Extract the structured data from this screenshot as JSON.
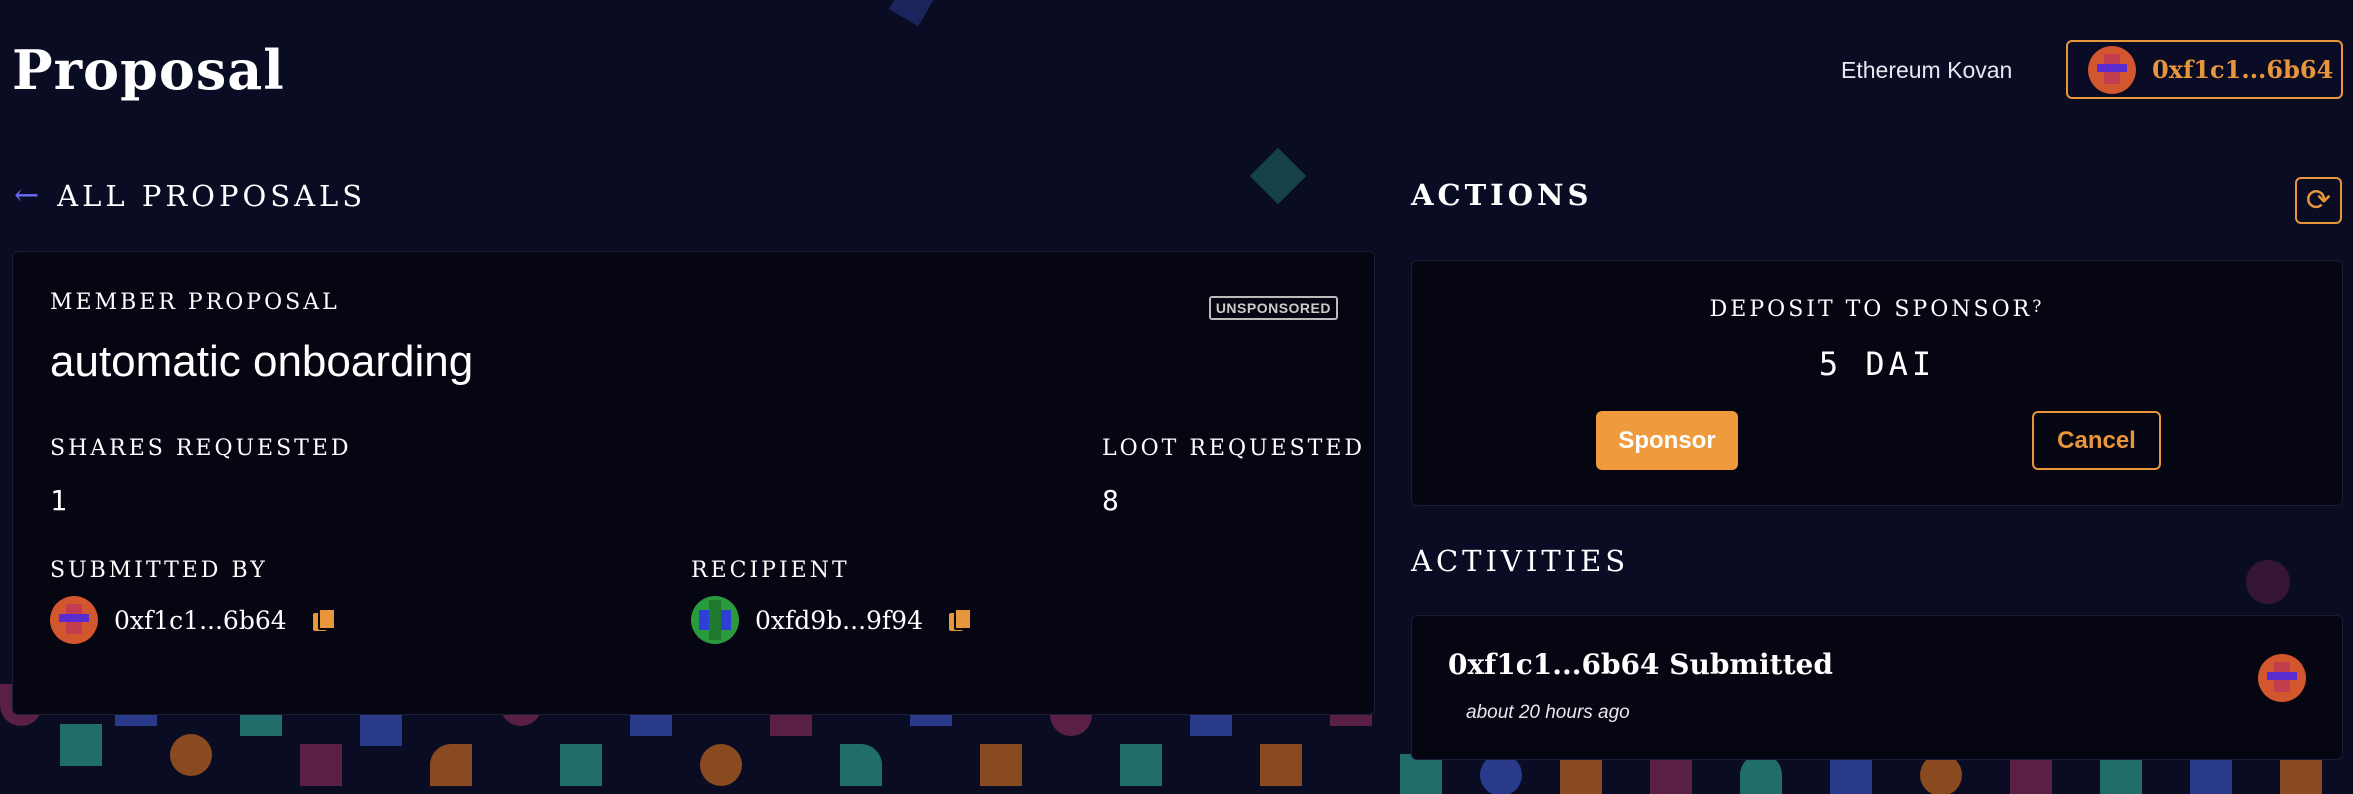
{
  "header": {
    "title": "Proposal",
    "network": "Ethereum Kovan",
    "account": "0xf1c1...6b64"
  },
  "back_link": {
    "label": "ALL PROPOSALS"
  },
  "proposal": {
    "type": "MEMBER PROPOSAL",
    "status_badge": "UNSPONSORED",
    "title": "automatic onboarding",
    "shares_label": "SHARES REQUESTED",
    "shares_value": "1",
    "loot_label": "LOOT REQUESTED",
    "loot_value": "8",
    "submitted_by_label": "SUBMITTED BY",
    "submitted_by": "0xf1c1...6b64",
    "recipient_label": "RECIPIENT",
    "recipient": "0xfd9b...9f94"
  },
  "actions": {
    "heading": "ACTIONS",
    "deposit_label": "DEPOSIT TO SPONSOR",
    "deposit_value": "5 DAI",
    "sponsor_label": "Sponsor",
    "cancel_label": "Cancel"
  },
  "activities": {
    "heading": "ACTIVITIES",
    "items": [
      {
        "title": "0xf1c1...6b64 Submitted",
        "time": "about 20 hours ago"
      }
    ]
  },
  "colors": {
    "background": "#0a0c24",
    "accent": "#e8963c",
    "back_arrow": "#6b6cf5"
  },
  "icons": [
    "back-arrow-icon",
    "copy-icon",
    "refresh-icon",
    "help-icon"
  ]
}
